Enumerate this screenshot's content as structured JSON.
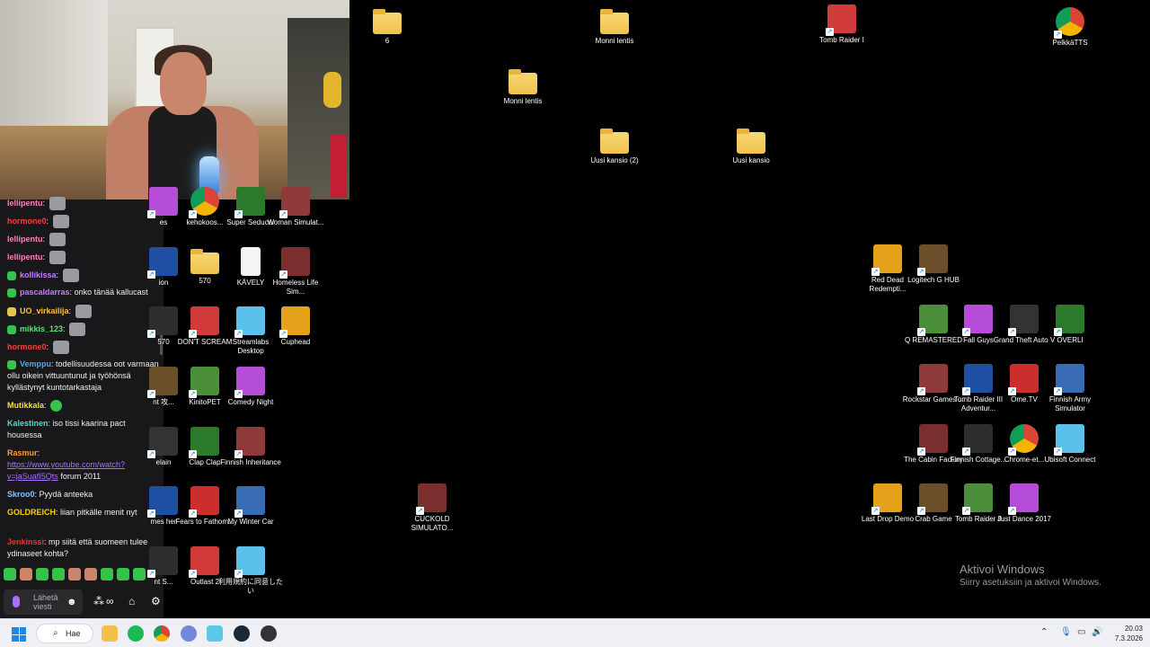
{
  "chat": {
    "messages": [
      {
        "name": "lellipentu",
        "text": "",
        "color": "#ff7fbf",
        "emote": true
      },
      {
        "name": "hormone0",
        "text": "",
        "color": "#ff3b3b",
        "emote": true
      },
      {
        "name": "lellipentu",
        "text": "",
        "color": "#ff7fbf",
        "emote": true
      },
      {
        "name": "lellipentu",
        "text": "",
        "color": "#ff7fbf",
        "emote": true
      },
      {
        "name": "kollikissa",
        "text": "",
        "color": "#c77dff",
        "emote": true
      },
      {
        "name": "pascaldarras",
        "text": "onko tänää kallucast",
        "color": "#c77dff",
        "emote": false
      },
      {
        "name": "UO_virkailija",
        "text": "",
        "color": "#ffc233",
        "emote": true
      },
      {
        "name": "mikkis_123",
        "text": "",
        "color": "#55e870",
        "emote": true
      },
      {
        "name": "hormone0",
        "text": "",
        "color": "#ff3b3b",
        "emote": true
      },
      {
        "name": "Vemppu",
        "text": "todellisuudessa oot varmaan ollu oikein vittuuntunut ja työhönsä kyllästynyt kuntotarkastaja",
        "color": "#4aa8ff",
        "emote": false
      },
      {
        "name": "Mutikkala",
        "text": "",
        "color": "#ffd84a",
        "emote": true
      },
      {
        "name": "Kalestinen",
        "text": "iso tissi kaarina pact housessa",
        "color": "#46e0c8",
        "emote": false
      },
      {
        "name": "Rasmur",
        "text": "forum 2011",
        "link": "https://www.youtube.com/watch?v=jaSuafI5Qts",
        "color": "#ff9a3c",
        "emote": false
      },
      {
        "name": "Skroo0",
        "text": "Pyydä anteeka",
        "color": "#7fc7ff",
        "emote": false
      },
      {
        "name": "GOLDREICH",
        "text": "liian pitkälle menit nyt",
        "color": "#ffd000",
        "emote": true
      },
      {
        "name": "Jenkinssi",
        "text": "mp siitä että suomeen tulee ydinaseet kohta?",
        "color": "#ff2a2a",
        "emote": false
      }
    ],
    "input_placeholder": "Lähetä viesti",
    "emote_icon": "smile-icon"
  },
  "desktop": {
    "icons": [
      {
        "label": "6",
        "kind": "folder"
      },
      {
        "label": "Monni lentis",
        "kind": "folder"
      },
      {
        "label": "Tomb Raider I",
        "kind": "app"
      },
      {
        "label": "PelkkäTTS",
        "kind": "chrome"
      },
      {
        "label": "Monni lentis",
        "kind": "folder"
      },
      {
        "label": "Uusi kansio (2)",
        "kind": "folder"
      },
      {
        "label": "Uusi kansio",
        "kind": "folder"
      },
      {
        "label": "es",
        "kind": "app"
      },
      {
        "label": "kehokoos...",
        "kind": "chrome"
      },
      {
        "label": "Super Seducer",
        "kind": "app"
      },
      {
        "label": "Woman Simulat...",
        "kind": "app"
      },
      {
        "label": "ion",
        "kind": "app"
      },
      {
        "label": "570",
        "kind": "folder"
      },
      {
        "label": "KÄVELY",
        "kind": "doc"
      },
      {
        "label": "Homeless Life Sim...",
        "kind": "app"
      },
      {
        "label": "570",
        "kind": "app"
      },
      {
        "label": "DON'T SCREAM",
        "kind": "app"
      },
      {
        "label": "Streamlabs Desktop",
        "kind": "app"
      },
      {
        "label": "Cuphead",
        "kind": "app"
      },
      {
        "label": "nt 攻...",
        "kind": "app"
      },
      {
        "label": "KinitoPET",
        "kind": "app"
      },
      {
        "label": "Comedy Night",
        "kind": "app"
      },
      {
        "label": "elain",
        "kind": "app"
      },
      {
        "label": "Clap Clap",
        "kind": "app"
      },
      {
        "label": "Finnish Inheritance",
        "kind": "app"
      },
      {
        "label": "mes her",
        "kind": "app"
      },
      {
        "label": "Fears to Fathom...",
        "kind": "app"
      },
      {
        "label": "My Winter Car",
        "kind": "app"
      },
      {
        "label": "CUCKOLD SIMULATO...",
        "kind": "app"
      },
      {
        "label": "nt S...",
        "kind": "app"
      },
      {
        "label": "Outlast 2",
        "kind": "app"
      },
      {
        "label": "利用規約に同意したい",
        "kind": "app"
      },
      {
        "label": "Red Dead Redempti...",
        "kind": "app"
      },
      {
        "label": "Logitech G HUB",
        "kind": "app"
      },
      {
        "label": "Q REMASTERED",
        "kind": "app"
      },
      {
        "label": "Fall Guys",
        "kind": "app"
      },
      {
        "label": "Grand Theft Auto V",
        "kind": "app"
      },
      {
        "label": "OVERLI",
        "kind": "app"
      },
      {
        "label": "Rockstar Games ...",
        "kind": "app"
      },
      {
        "label": "Tomb Raider III Adventur...",
        "kind": "app"
      },
      {
        "label": "Ome.TV",
        "kind": "app"
      },
      {
        "label": "Finnish Army Simulator",
        "kind": "app"
      },
      {
        "label": "The Cabin Factory",
        "kind": "app"
      },
      {
        "label": "Finnish Cottage...",
        "kind": "app"
      },
      {
        "label": "Chrome-et...",
        "kind": "chrome"
      },
      {
        "label": "Ubisoft Connect",
        "kind": "app"
      },
      {
        "label": "Last Drop Demo",
        "kind": "app"
      },
      {
        "label": "Crab Game",
        "kind": "app"
      },
      {
        "label": "Tomb Raider II",
        "kind": "app"
      },
      {
        "label": "Just Dance 2017",
        "kind": "app"
      }
    ]
  },
  "activate": {
    "title": "Aktivoi Windows",
    "subtitle": "Siirry asetuksiin ja aktivoi Windows."
  },
  "taskbar": {
    "search_label": "Hae",
    "time": "20.03",
    "date": "7.3.2026"
  }
}
